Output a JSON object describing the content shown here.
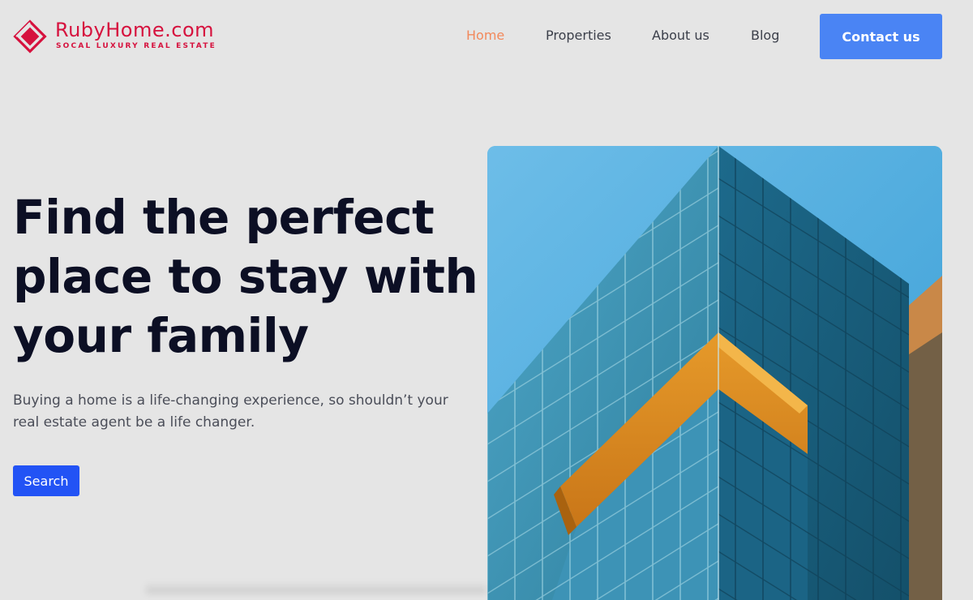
{
  "brand": {
    "name": "RubyHome.com",
    "tagline": "SOCAL LUXURY REAL ESTATE",
    "color": "#d6123e",
    "icon": "diamond-logo-icon"
  },
  "nav": {
    "items": [
      {
        "label": "Home",
        "active": true
      },
      {
        "label": "Properties",
        "active": false
      },
      {
        "label": "About us",
        "active": false
      },
      {
        "label": "Blog",
        "active": false
      }
    ],
    "contact_label": "Contact us",
    "active_color": "#f2895c",
    "button_color": "#4a84f4"
  },
  "hero": {
    "title": "Find the perfect place to stay with your family",
    "subtitle": "Buying a home is a life-changing experience, so shouldn’t your real estate agent be a life changer.",
    "search_label": "Search",
    "search_color": "#2253f5",
    "image": "glass-building-photo"
  }
}
